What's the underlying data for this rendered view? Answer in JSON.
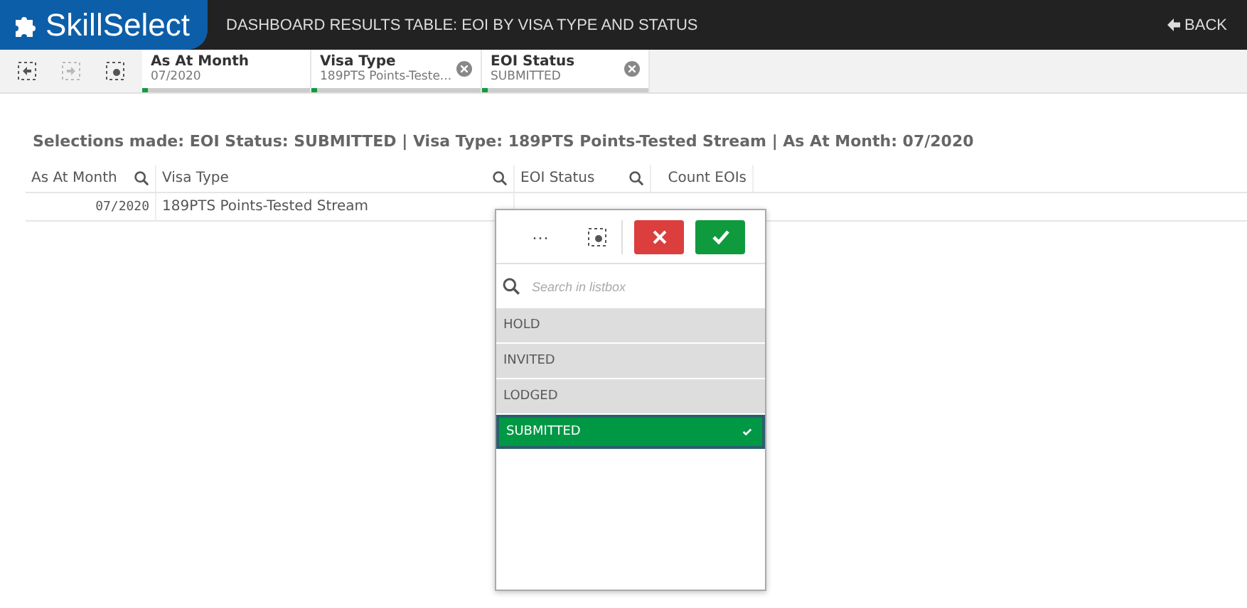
{
  "header": {
    "logo": "SkillSelect",
    "title": "DASHBOARD RESULTS TABLE: EOI BY VISA TYPE AND STATUS",
    "back": "BACK"
  },
  "selections": [
    {
      "field": "As At Month",
      "value": "07/2020",
      "clearable": false
    },
    {
      "field": "Visa Type",
      "value": "189PTS Points-Teste...",
      "clearable": true
    },
    {
      "field": "EOI Status",
      "value": "SUBMITTED",
      "clearable": true
    }
  ],
  "summary": "Selections made: EOI Status: SUBMITTED | Visa Type: 189PTS Points-Tested Stream | As At Month: 07/2020",
  "table": {
    "columns": [
      {
        "label": "As At Month",
        "searchable": true
      },
      {
        "label": "Visa Type",
        "searchable": true
      },
      {
        "label": "EOI Status",
        "searchable": true
      },
      {
        "label": "Count EOIs",
        "searchable": false
      }
    ],
    "rows": [
      [
        "07/2020",
        "189PTS Points-Tested Stream"
      ]
    ]
  },
  "listbox": {
    "more": "···",
    "search_placeholder": "Search in listbox",
    "items": [
      {
        "label": "HOLD",
        "selected": false
      },
      {
        "label": "INVITED",
        "selected": false
      },
      {
        "label": "LODGED",
        "selected": false
      },
      {
        "label": "SUBMITTED",
        "selected": true
      }
    ]
  }
}
